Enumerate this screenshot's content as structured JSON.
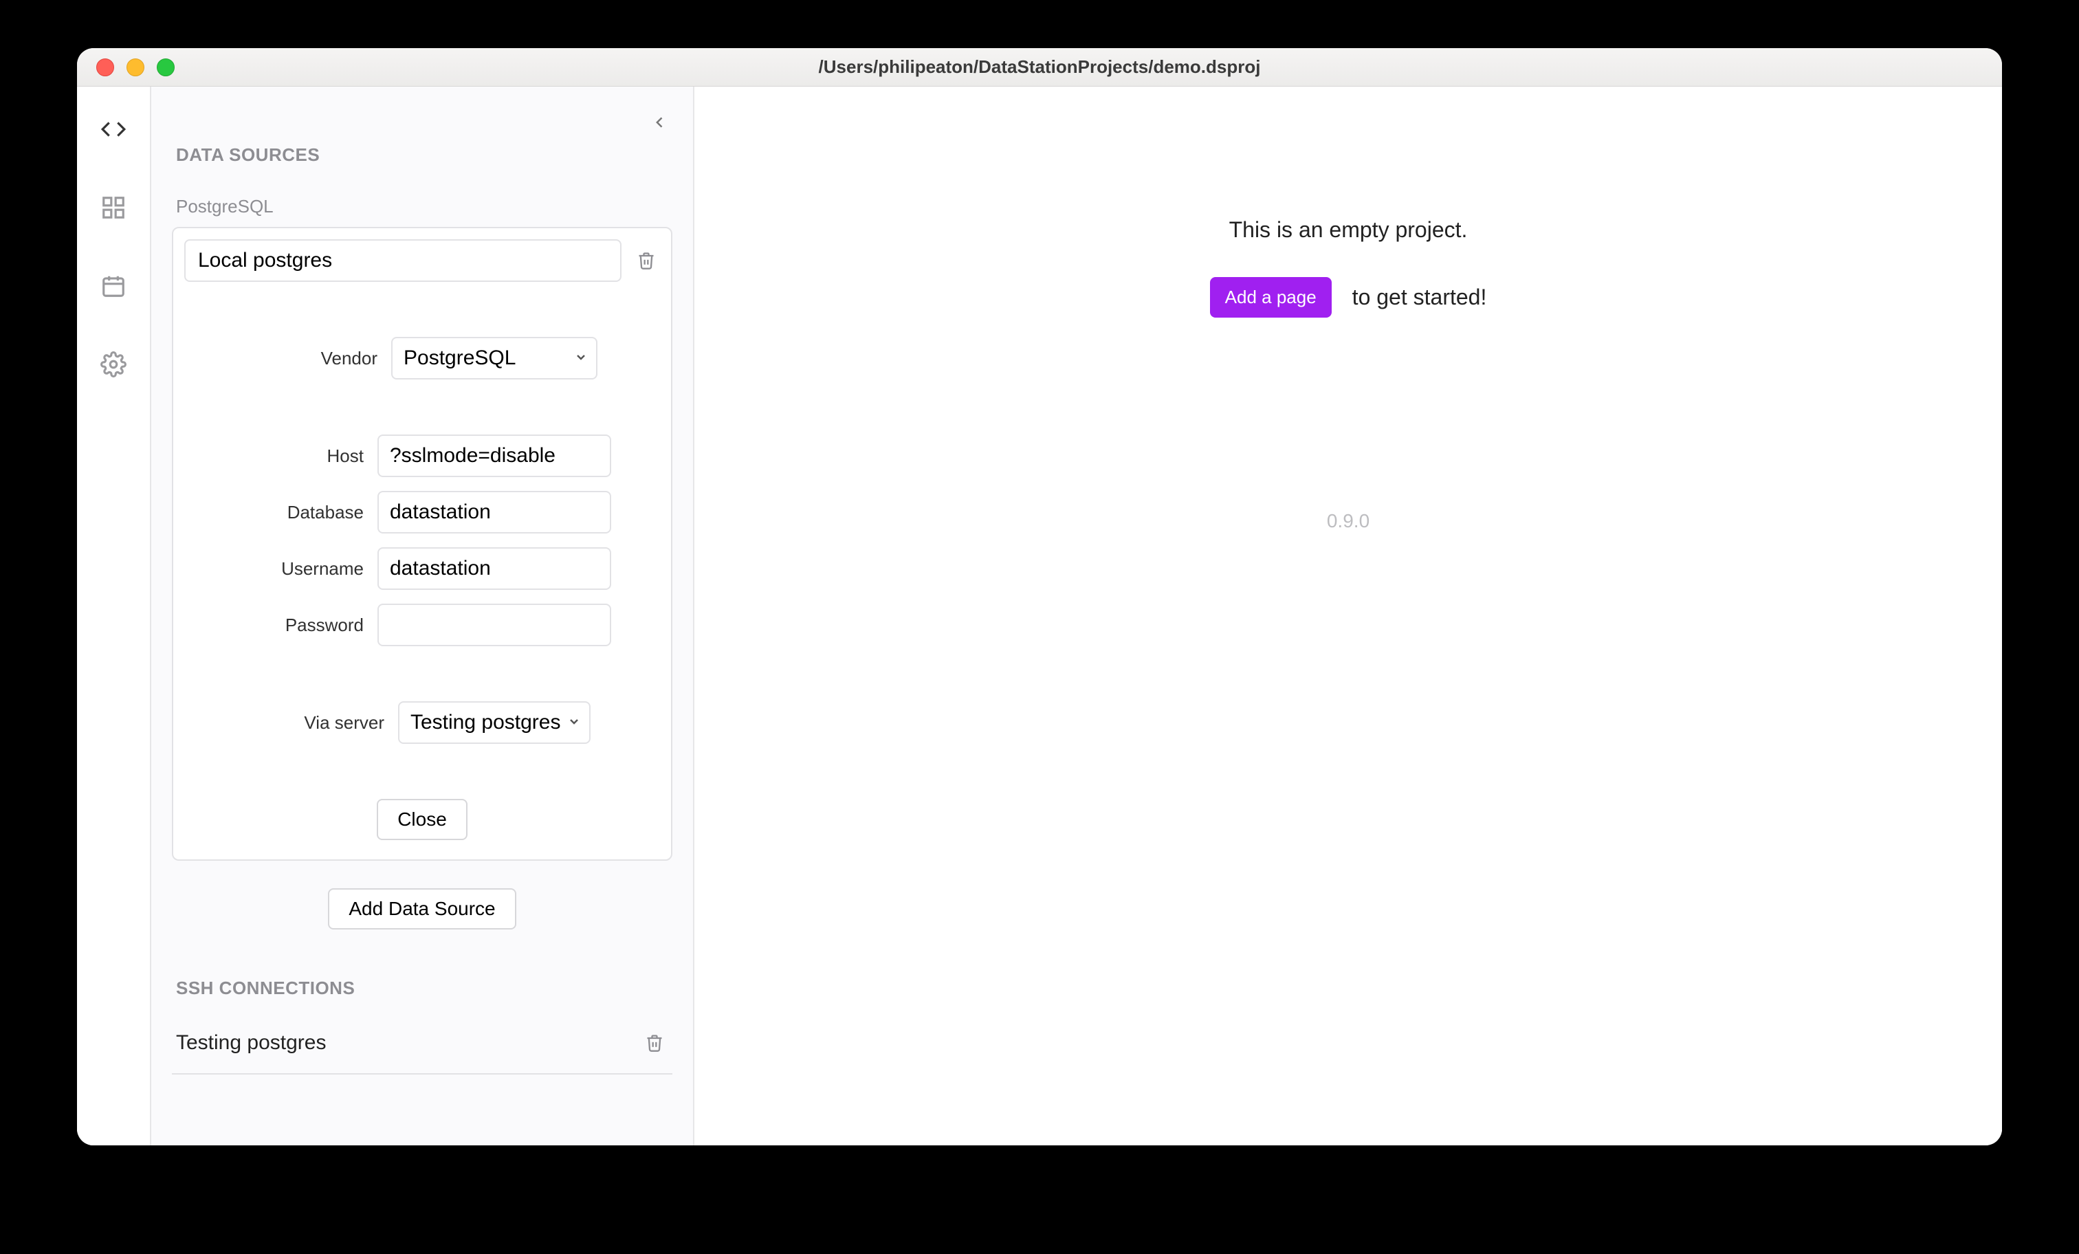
{
  "window": {
    "title": "/Users/philipeaton/DataStationProjects/demo.dsproj"
  },
  "sidebar": {
    "section_data_sources": "DATA SOURCES",
    "section_ssh": "SSH CONNECTIONS",
    "ds_type_label": "PostgreSQL",
    "data_source": {
      "name": "Local postgres",
      "vendor_label": "Vendor",
      "vendor_value": "PostgreSQL",
      "host_label": "Host",
      "host_value": "?sslmode=disable",
      "database_label": "Database",
      "database_value": "datastation",
      "username_label": "Username",
      "username_value": "datastation",
      "password_label": "Password",
      "password_value": "",
      "via_label": "Via server",
      "via_value": "Testing postgres",
      "close_label": "Close"
    },
    "add_data_source_label": "Add Data Source",
    "ssh_connection": {
      "name": "Testing postgres"
    }
  },
  "main": {
    "empty_title": "This is an empty project.",
    "add_page_label": "Add a page",
    "cta_suffix": "to get started!",
    "version": "0.9.0"
  }
}
